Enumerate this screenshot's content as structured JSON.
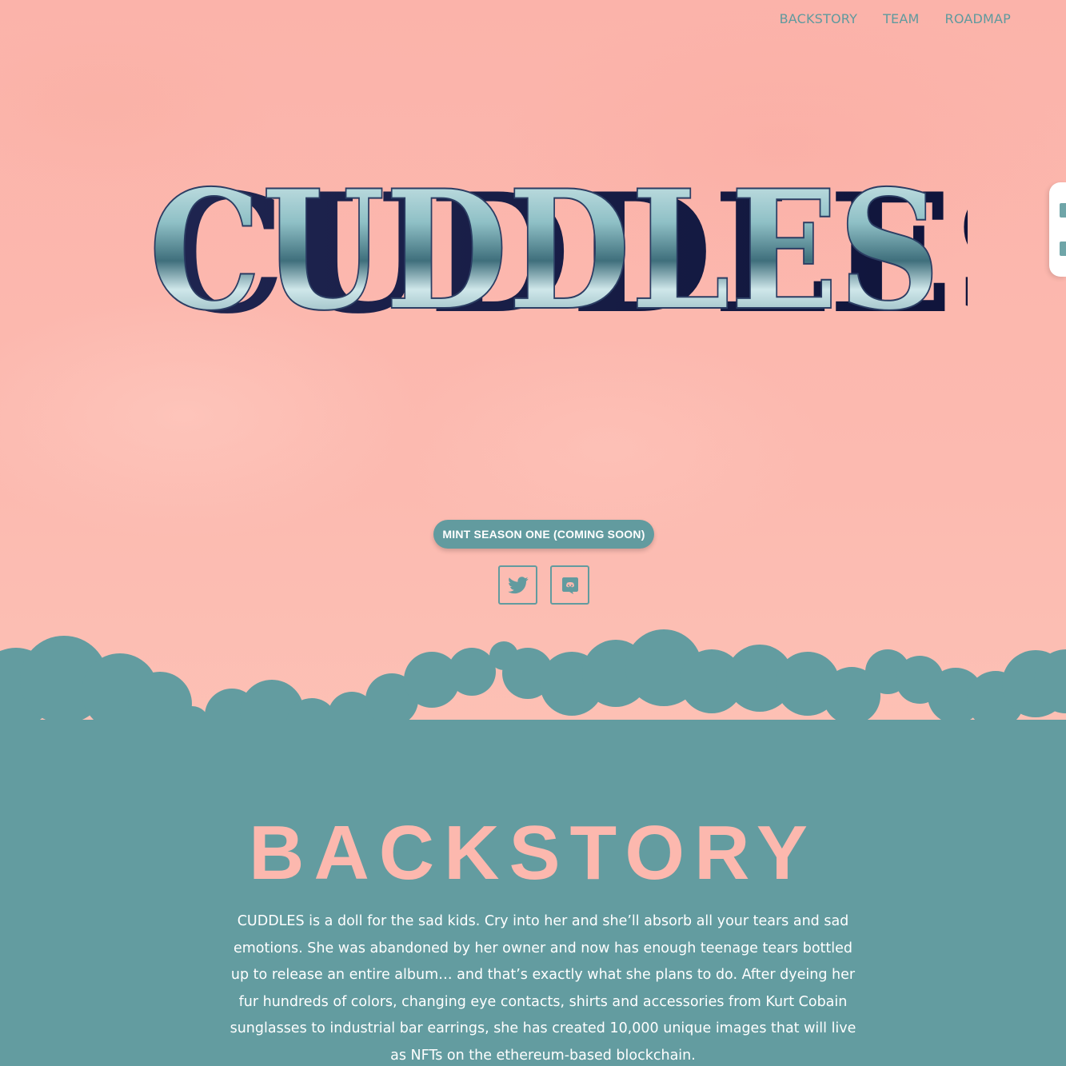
{
  "nav": {
    "items": [
      "BACKSTORY",
      "TEAM",
      "ROADMAP"
    ]
  },
  "hero": {
    "logo_text": "CUDDLES",
    "mint_button_label": "MINT SEASON ONE (COMING SOON)",
    "social": [
      "twitter-icon",
      "discord-icon"
    ]
  },
  "backstory": {
    "title": "BACKSTORY",
    "body": "CUDDLES is a doll for the sad kids. Cry into her and she’ll absorb all your tears and sad emotions. She was abandoned by her owner and now has enough teenage tears bottled up to release an entire album… and that’s exactly what she plans to do. After dyeing her fur hundreds of colors, changing eye contacts, shirts and accessories from Kurt Cobain sunglasses to industrial bar earrings, she has created 10,000 unique images that will live as NFTs on the ethereum-based blockchain."
  },
  "colors": {
    "background_pink": "#fcb8ae",
    "teal": "#639ca0",
    "white": "#ffffff"
  }
}
